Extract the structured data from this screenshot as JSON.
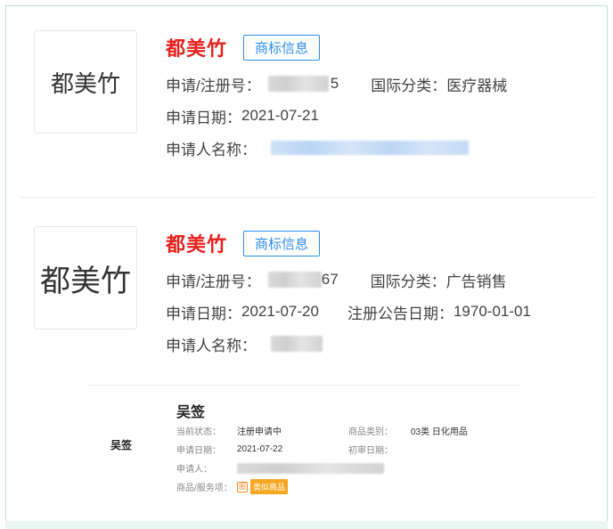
{
  "records": [
    {
      "logo_text": "都美竹",
      "name": "都美竹",
      "button": "商标信息",
      "reg_no_label": "申请/注册号：",
      "reg_no_suffix": "5",
      "intl_class_label": "国际分类：",
      "intl_class_value": "医疗器械",
      "apply_date_label": "申请日期：",
      "apply_date_value": "2021-07-21",
      "applicant_label": "申请人名称："
    },
    {
      "logo_text": "都美竹",
      "name": "都美竹",
      "button": "商标信息",
      "reg_no_label": "申请/注册号：",
      "reg_no_suffix": "67",
      "intl_class_label": "国际分类：",
      "intl_class_value": "广告销售",
      "apply_date_label": "申请日期：",
      "apply_date_value": "2021-07-20",
      "announce_label": "注册公告日期：",
      "announce_value": "1970-01-01",
      "applicant_label": "申请人名称："
    }
  ],
  "record3": {
    "logo_text": "吴签",
    "name": "吴签",
    "status_label": "当前状态：",
    "status_value": "注册申请中",
    "category_label": "商品类别：",
    "category_value": "03类 日化用品",
    "apply_date_label": "申请日期：",
    "apply_date_value": "2021-07-22",
    "first_review_label": "初审日期：",
    "applicant_label": "申请人：",
    "goods_label": "商品/服务项：",
    "goods_badge": "类似商品"
  },
  "colors": {
    "brand_red": "#e8211e",
    "link_blue": "#2f8ee8",
    "frame_border": "#b9e3d6",
    "badge_orange": "#f5a623"
  }
}
